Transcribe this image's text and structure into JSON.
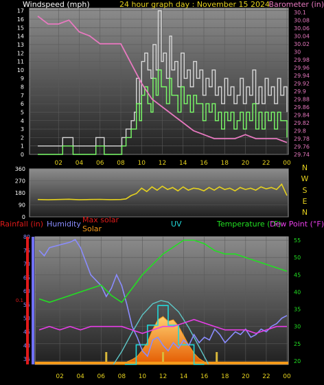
{
  "page": {
    "title": "24 hour graph day : November 15 2024"
  },
  "colors": {
    "background": "#000000",
    "wind_gust": "#d8d8d8",
    "wind_avg": "#7cff6a",
    "barometer": "#e879c0",
    "direction": "#e6d21e",
    "humidity": "#8a8cff",
    "temperature": "#22e022",
    "dew_point": "#e83ee8",
    "solar": "#f59a1a",
    "max_solar": "#5ec8c8",
    "uv": "#22d8d8",
    "rain": "#e01a1a",
    "title": "#e6d21e"
  },
  "chart_data": [
    {
      "id": "wind-barometer",
      "type": "line",
      "title": "24 hour graph day : November 15 2024",
      "left_axis_label": "Windspeed (mph)",
      "right_axis_label": "Barometer (in)",
      "x_ticks": [
        "02",
        "04",
        "06",
        "08",
        "10",
        "12",
        "14",
        "16",
        "18",
        "20",
        "22",
        "00"
      ],
      "y_left_ticks": [
        "0",
        "1",
        "2",
        "3",
        "4",
        "5",
        "6",
        "7",
        "8",
        "9",
        "10",
        "11",
        "12",
        "13",
        "14",
        "15",
        "16",
        "17"
      ],
      "y_right_ticks": [
        "29.74",
        "29.76",
        "29.78",
        "29.8",
        "29.82",
        "29.84",
        "29.86",
        "29.88",
        "29.9",
        "29.92",
        "29.94",
        "29.96",
        "29.98",
        "30",
        "30.02",
        "30.04",
        "30.06",
        "30.08",
        "30.1"
      ],
      "ylim_left": [
        0,
        17.3
      ],
      "ylim_right": [
        29.74,
        30.11
      ],
      "series": [
        {
          "key": "gust",
          "x": [
            0,
            2.3,
            2.4,
            3.3,
            3.4,
            5.5,
            5.6,
            6.3,
            6.4,
            8.0,
            8.1,
            8.5,
            9.0,
            9.3,
            9.5,
            9.8,
            10.0,
            10.3,
            10.6,
            10.9,
            11.1,
            11.4,
            11.6,
            11.9,
            12.1,
            12.4,
            12.7,
            12.9,
            13.2,
            13.5,
            13.8,
            14.1,
            14.4,
            14.7,
            15.0,
            15.3,
            15.6,
            15.9,
            16.2,
            16.5,
            16.8,
            17.1,
            17.4,
            17.7,
            18.0,
            18.3,
            18.6,
            18.9,
            19.2,
            19.5,
            19.8,
            20.1,
            20.4,
            20.7,
            21.0,
            21.3,
            21.6,
            21.9,
            22.2,
            22.5,
            22.8,
            23.1,
            23.4,
            23.7,
            24.0
          ],
          "y": [
            1,
            1,
            2,
            2,
            1,
            1,
            2,
            2,
            1,
            1,
            2,
            3,
            4,
            5,
            9,
            6,
            11,
            12,
            10,
            9,
            13,
            10,
            17,
            11,
            12,
            9,
            14,
            10,
            11,
            8,
            12,
            9,
            10,
            8,
            11,
            9,
            10,
            7,
            9,
            8,
            10,
            7,
            8,
            6,
            9,
            7,
            8,
            6,
            7,
            9,
            6,
            8,
            7,
            10,
            6,
            8,
            6,
            9,
            7,
            8,
            6,
            9,
            7,
            8,
            5
          ]
        },
        {
          "key": "avg",
          "x": [
            0,
            2.3,
            2.4,
            3.3,
            3.4,
            5.5,
            5.6,
            6.3,
            6.4,
            8.0,
            8.1,
            8.5,
            9.0,
            9.3,
            9.5,
            9.8,
            10.0,
            10.3,
            10.6,
            10.9,
            11.1,
            11.4,
            11.6,
            11.9,
            12.1,
            12.4,
            12.7,
            12.9,
            13.2,
            13.5,
            13.8,
            14.1,
            14.4,
            14.7,
            15.0,
            15.3,
            15.6,
            15.9,
            16.2,
            16.5,
            16.8,
            17.1,
            17.4,
            17.7,
            18.0,
            18.3,
            18.6,
            18.9,
            19.2,
            19.5,
            19.8,
            20.1,
            20.4,
            20.7,
            21.0,
            21.3,
            21.6,
            21.9,
            22.2,
            22.5,
            22.8,
            23.1,
            23.4,
            23.7,
            24.0
          ],
          "y": [
            0,
            0,
            1,
            1,
            0,
            0,
            1,
            1,
            0,
            0,
            1,
            2,
            3,
            3,
            6,
            4,
            7,
            8,
            6,
            5,
            9,
            7,
            10,
            8,
            8,
            6,
            9,
            7,
            7,
            5,
            8,
            6,
            7,
            5,
            7,
            6,
            6,
            4,
            6,
            5,
            6,
            4,
            5,
            3,
            5,
            4,
            5,
            3,
            4,
            5,
            3,
            5,
            4,
            6,
            3,
            5,
            3,
            5,
            4,
            5,
            3,
            5,
            4,
            4,
            2
          ]
        },
        {
          "key": "barometer",
          "x": [
            0,
            1,
            2,
            3,
            4,
            5,
            6,
            7,
            8,
            9,
            10,
            11,
            12,
            13,
            14,
            15,
            16,
            17,
            18,
            19,
            20,
            21,
            22,
            23,
            24
          ],
          "y": [
            30.09,
            30.07,
            30.07,
            30.08,
            30.05,
            30.04,
            30.02,
            30.02,
            30.02,
            29.97,
            29.92,
            29.88,
            29.86,
            29.84,
            29.82,
            29.8,
            29.79,
            29.78,
            29.78,
            29.78,
            29.79,
            29.78,
            29.78,
            29.78,
            29.77
          ]
        }
      ]
    },
    {
      "id": "wind-direction",
      "type": "line",
      "left_ticks": [
        "360",
        "270",
        "180",
        "90",
        "0"
      ],
      "right_ticks": [
        "N",
        "W",
        "S",
        "E",
        "N"
      ],
      "ylim": [
        0,
        360
      ],
      "series": [
        {
          "key": "direction",
          "x": [
            0,
            1,
            2,
            3,
            4,
            5,
            6,
            7,
            8,
            8.5,
            9,
            9.5,
            10,
            10.5,
            11,
            11.5,
            12,
            12.5,
            13,
            13.5,
            14,
            14.5,
            15,
            15.5,
            16,
            16.5,
            17,
            17.5,
            18,
            18.5,
            19,
            19.5,
            20,
            20.5,
            21,
            21.5,
            22,
            22.5,
            23,
            23.5,
            24
          ],
          "y": [
            130,
            128,
            130,
            132,
            128,
            130,
            131,
            129,
            130,
            135,
            160,
            175,
            215,
            190,
            225,
            200,
            230,
            205,
            220,
            195,
            225,
            200,
            215,
            210,
            195,
            220,
            200,
            225,
            205,
            215,
            195,
            220,
            205,
            215,
            200,
            225,
            210,
            220,
            205,
            245,
            160
          ]
        }
      ]
    },
    {
      "id": "weather-combo",
      "type": "line",
      "legend": [
        "Rainfall (in)",
        "Humidity",
        "Max solar",
        "Solar",
        "UV",
        "Temperature (°F)",
        "Dew Point (°F)"
      ],
      "rain_ticks": [
        "0.1"
      ],
      "humidity_ticks": [
        "35",
        "40",
        "45",
        "50",
        "55",
        "60",
        "65",
        "70",
        "75",
        "80"
      ],
      "temp_ticks": [
        "20",
        "25",
        "30",
        "35",
        "40",
        "45",
        "50",
        "55"
      ],
      "x_ticks": [
        "02",
        "04",
        "06",
        "08",
        "10",
        "12",
        "14",
        "16",
        "18",
        "20",
        "22",
        "00"
      ],
      "humidity_ylim": [
        33,
        80
      ],
      "temp_ylim": [
        19,
        56
      ],
      "series": [
        {
          "key": "humidity",
          "x": [
            0,
            0.5,
            1,
            2,
            3,
            3.5,
            4,
            4.5,
            5,
            5.5,
            6,
            6.5,
            7,
            7.5,
            8,
            8.5,
            9,
            9.5,
            10,
            10.5,
            11,
            11.5,
            12,
            12.5,
            13,
            13.5,
            14,
            14.5,
            15,
            15.5,
            16,
            16.5,
            17,
            17.5,
            18,
            18.5,
            19,
            19.5,
            20,
            20.5,
            21,
            21.5,
            22,
            22.5,
            23,
            23.5,
            24
          ],
          "y": [
            75,
            73,
            76,
            77,
            78,
            79,
            76,
            71,
            66,
            64,
            62,
            58,
            61,
            66,
            62,
            55,
            47,
            43,
            38,
            36,
            42,
            43,
            40,
            38,
            41,
            39,
            42,
            40,
            44,
            41,
            43,
            42,
            46,
            44,
            41,
            43,
            45,
            44,
            46,
            43,
            44,
            46,
            45,
            47,
            48,
            50,
            51
          ]
        },
        {
          "key": "temperature",
          "x": [
            0,
            1,
            2,
            3,
            4,
            5,
            6,
            7,
            8,
            9,
            10,
            11,
            12,
            13,
            14,
            15,
            16,
            17,
            18,
            19,
            20,
            21,
            22,
            23,
            24
          ],
          "y": [
            38,
            37,
            38,
            39,
            40,
            41,
            42,
            39,
            37,
            41,
            45,
            48,
            51,
            53,
            55,
            55,
            54,
            52,
            51,
            51,
            50,
            49,
            48,
            47,
            46
          ]
        },
        {
          "key": "dew_point",
          "x": [
            0,
            1,
            2,
            3,
            4,
            5,
            6,
            7,
            8,
            9,
            10,
            11,
            12,
            13,
            14,
            15,
            16,
            17,
            18,
            19,
            20,
            21,
            22,
            23,
            24
          ],
          "y": [
            29,
            30,
            29,
            30,
            29,
            30,
            30,
            30,
            30,
            29,
            28,
            29,
            30,
            30,
            31,
            32,
            31,
            30,
            29,
            29,
            29,
            28,
            29,
            30,
            30
          ]
        },
        {
          "key": "solar",
          "x": [
            7.3,
            8,
            8.5,
            9,
            9.5,
            10,
            10.5,
            11,
            11.5,
            12,
            12.5,
            13,
            13.5,
            14,
            14.5,
            15,
            15.5,
            16,
            16.5
          ],
          "y": [
            0,
            3,
            8,
            15,
            25,
            45,
            70,
            110,
            140,
            150,
            135,
            140,
            120,
            90,
            60,
            35,
            18,
            8,
            0
          ]
        },
        {
          "key": "max_solar",
          "x": [
            7.2,
            8,
            9,
            10,
            11,
            11.8,
            12.5,
            13.5,
            14.5,
            15.5,
            16.4
          ],
          "y": [
            0,
            40,
            100,
            155,
            190,
            200,
            195,
            165,
            115,
            55,
            0
          ]
        },
        {
          "key": "uv",
          "x": [
            8.3,
            9,
            9.4,
            10,
            10.5,
            11,
            11.5,
            12,
            12.5,
            13,
            13.5,
            14,
            14.5,
            15,
            15.5,
            16
          ],
          "y": [
            0,
            0,
            1,
            1,
            2,
            2,
            3,
            3,
            2,
            2,
            1,
            1,
            1,
            0,
            0,
            0
          ]
        }
      ]
    }
  ]
}
